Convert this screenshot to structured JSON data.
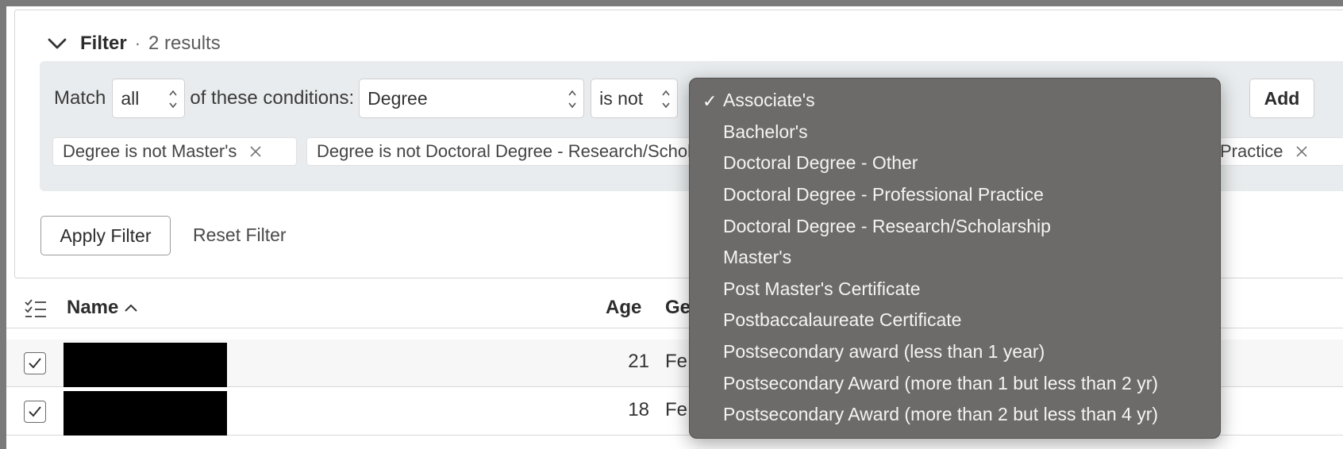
{
  "filter": {
    "title": "Filter",
    "separator": "·",
    "result_count": "2 results",
    "match_label": "Match",
    "match_value": "all",
    "conditions_label": "of these conditions:",
    "field_value": "Degree",
    "operator_value": "is not",
    "add_label": "Add",
    "chips": [
      {
        "label": "Degree is not Master's"
      },
      {
        "label": "Degree is not Doctoral Degree - Research/Scholarship"
      },
      {
        "label": "Practice"
      }
    ],
    "apply_label": "Apply Filter",
    "reset_label": "Reset Filter"
  },
  "dropdown": {
    "selected_index": 0,
    "options": [
      "Associate's",
      "Bachelor's",
      "Doctoral Degree - Other",
      "Doctoral Degree - Professional Practice",
      "Doctoral Degree - Research/Scholarship",
      "Master's",
      "Post Master's Certificate",
      "Postbaccalaureate Certificate",
      "Postsecondary award (less than 1 year)",
      "Postsecondary Award (more than 1 but less than 2 yr)",
      "Postsecondary Award (more than 2 but less than 4 yr)"
    ],
    "check_glyph": "✓"
  },
  "table": {
    "headers": {
      "name": "Name",
      "age": "Age",
      "gender_partial": "Ge"
    },
    "rows": [
      {
        "age": "21",
        "gender_partial": "Fe",
        "checked": true
      },
      {
        "age": "18",
        "gender_partial": "Fe",
        "checked": true
      }
    ]
  },
  "icons": {
    "collapse": "chevron-down-icon",
    "remove": "close-icon",
    "columns": "list-checks-icon",
    "sort": "chevron-up-icon",
    "checkbox": "check-icon"
  }
}
